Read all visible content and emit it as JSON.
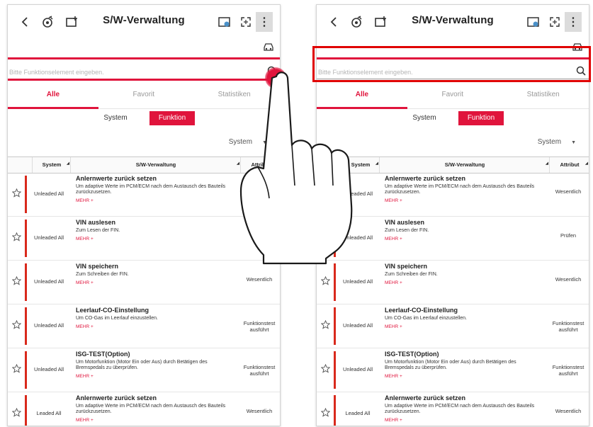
{
  "screen": {
    "title": "S/W-Verwaltung",
    "search_placeholder": "Bitte Funktionselement eingeben.",
    "tabs": [
      "Alle",
      "Favorit",
      "Statistiken"
    ],
    "segments": {
      "system": "System",
      "function": "Funktion"
    },
    "filter_value": "System",
    "columns": {
      "system": "System",
      "sw": "S/W-Verwaltung",
      "attribute": "Attribut"
    },
    "more_label": "MEHR +",
    "rows": [
      {
        "system": "Unleaded All",
        "title": "Anlernwerte zurück setzen",
        "desc": "Um adaptive Werte im PCM/ECM nach dem Austausch des Bauteils zurückzusetzen.",
        "attribute": "Wesentlich"
      },
      {
        "system": "Unleaded All",
        "title": "VIN auslesen",
        "desc": "Zum Lesen der FIN.",
        "attribute": "Prüfen"
      },
      {
        "system": "Unleaded All",
        "title": "VIN speichern",
        "desc": "Zum Schreiben der FIN.",
        "attribute": "Wesentlich"
      },
      {
        "system": "Unleaded All",
        "title": "Leerlauf-CO-Einstellung",
        "desc": "Um CO-Gas im Leerlauf einzustellen.",
        "attribute": "Funktionstest ausführt"
      },
      {
        "system": "Unleaded All",
        "title": "ISG-TEST(Option)",
        "desc": "Um Motorfunktion (Motor Ein oder Aus) durch Betätigen des Bremspedals zu überprüfen.",
        "attribute": "Funktionstest ausführt"
      },
      {
        "system": "Leaded All",
        "title": "Anlernwerte zurück setzen",
        "desc": "Um adaptive Werte im PCM/ECM nach dem Austausch des Bauteils zurückzusetzen.",
        "attribute": "Wesentlich"
      }
    ]
  },
  "colors": {
    "accent": "#e0143c",
    "row_bar": "#d9291c",
    "highlight": "#e00000"
  },
  "icons": [
    "back-icon",
    "vci-icon",
    "screenshot-icon",
    "media-icon",
    "fullscreen-icon",
    "car-icon",
    "search-icon",
    "star-icon",
    "hand-pointer-icon"
  ]
}
